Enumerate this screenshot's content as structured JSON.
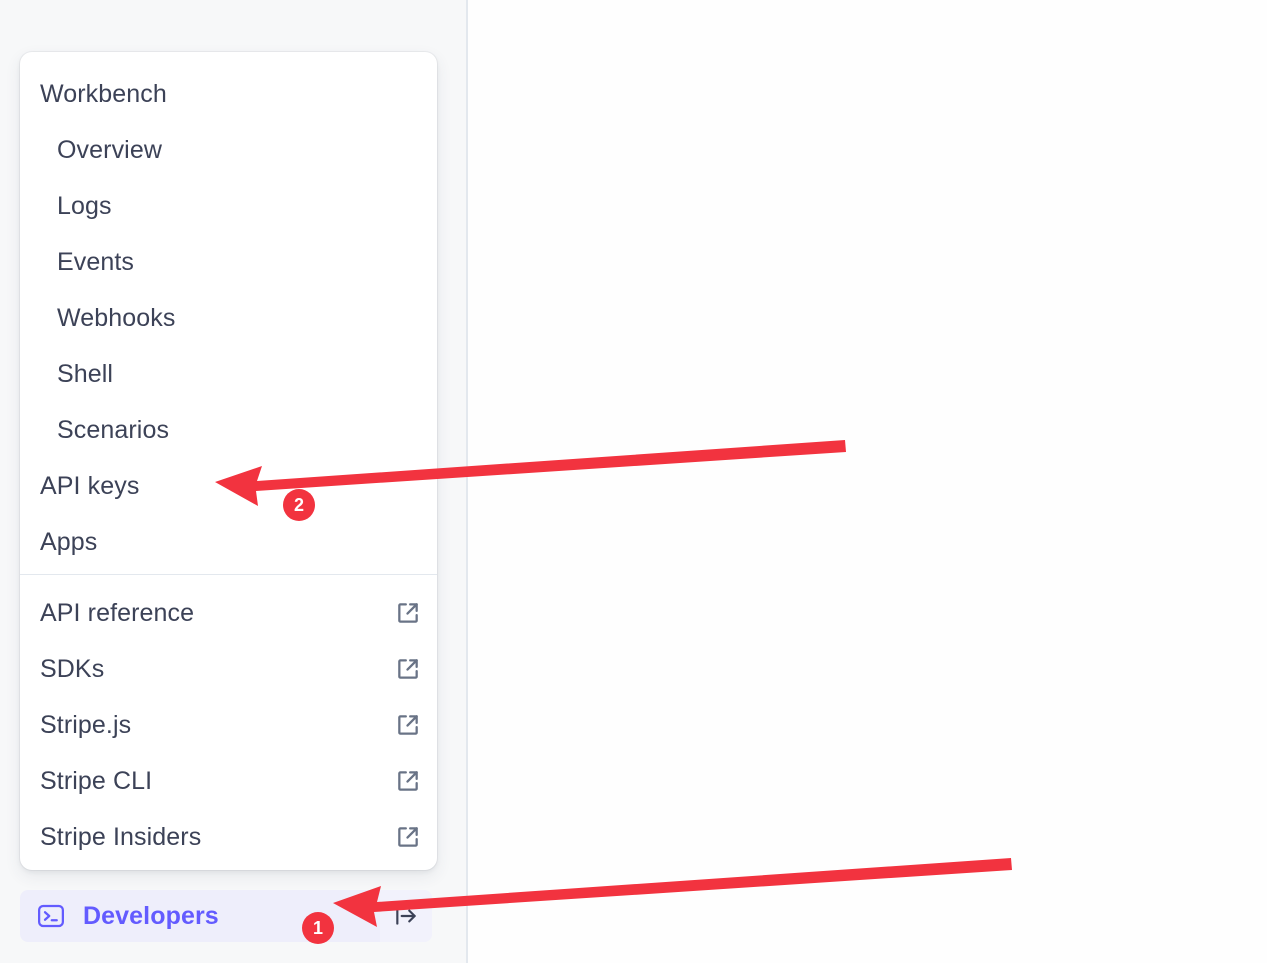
{
  "flyout": {
    "sections": [
      {
        "name": "workbench-section",
        "items": [
          {
            "label": "Workbench",
            "indent": "root"
          },
          {
            "label": "Overview",
            "indent": "child"
          },
          {
            "label": "Logs",
            "indent": "child"
          },
          {
            "label": "Events",
            "indent": "child"
          },
          {
            "label": "Webhooks",
            "indent": "child"
          },
          {
            "label": "Shell",
            "indent": "child"
          },
          {
            "label": "Scenarios",
            "indent": "child"
          },
          {
            "label": "API keys",
            "indent": "root"
          },
          {
            "label": "Apps",
            "indent": "root"
          }
        ]
      },
      {
        "name": "resources-section",
        "items": [
          {
            "label": "API reference",
            "icon": "external-link-icon"
          },
          {
            "label": "SDKs",
            "icon": "external-link-icon"
          },
          {
            "label": "Stripe.js",
            "icon": "external-link-icon"
          },
          {
            "label": "Stripe CLI",
            "icon": "external-link-icon"
          },
          {
            "label": "Stripe Insiders",
            "icon": "external-link-icon"
          }
        ]
      }
    ]
  },
  "developers_bar": {
    "label": "Developers",
    "icon": "terminal-icon",
    "collapse_icon": "arrow-right-from-line-icon",
    "accent_color": "#635bff",
    "background_color": "#eeeefb"
  },
  "annotations": {
    "color": "#f2333f",
    "steps": [
      {
        "number": "1",
        "target": "Developers"
      },
      {
        "number": "2",
        "target": "API keys"
      }
    ]
  }
}
